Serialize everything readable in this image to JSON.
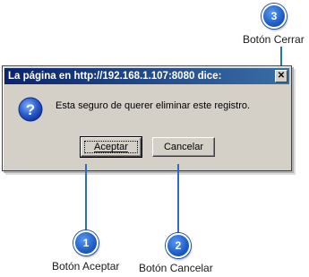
{
  "dialog": {
    "title": "La página en http://192.168.1.107:8080 dice:",
    "message": "Esta seguro de querer eliminar este registro.",
    "icon": "question-icon",
    "buttons": {
      "accept_label": "Aceptar",
      "cancel_label": "Cancelar"
    },
    "close_symbol": "✕"
  },
  "callouts": [
    {
      "number": "1",
      "label": "Botón Aceptar"
    },
    {
      "number": "2",
      "label": "Botón Cancelar"
    },
    {
      "number": "3",
      "label": "Botón Cerrar"
    }
  ],
  "colors": {
    "badge": "#1e5cc8",
    "titlebar_start": "#0a246a",
    "titlebar_end": "#3a6ea5",
    "dialog_bg": "#d4d0c8"
  }
}
